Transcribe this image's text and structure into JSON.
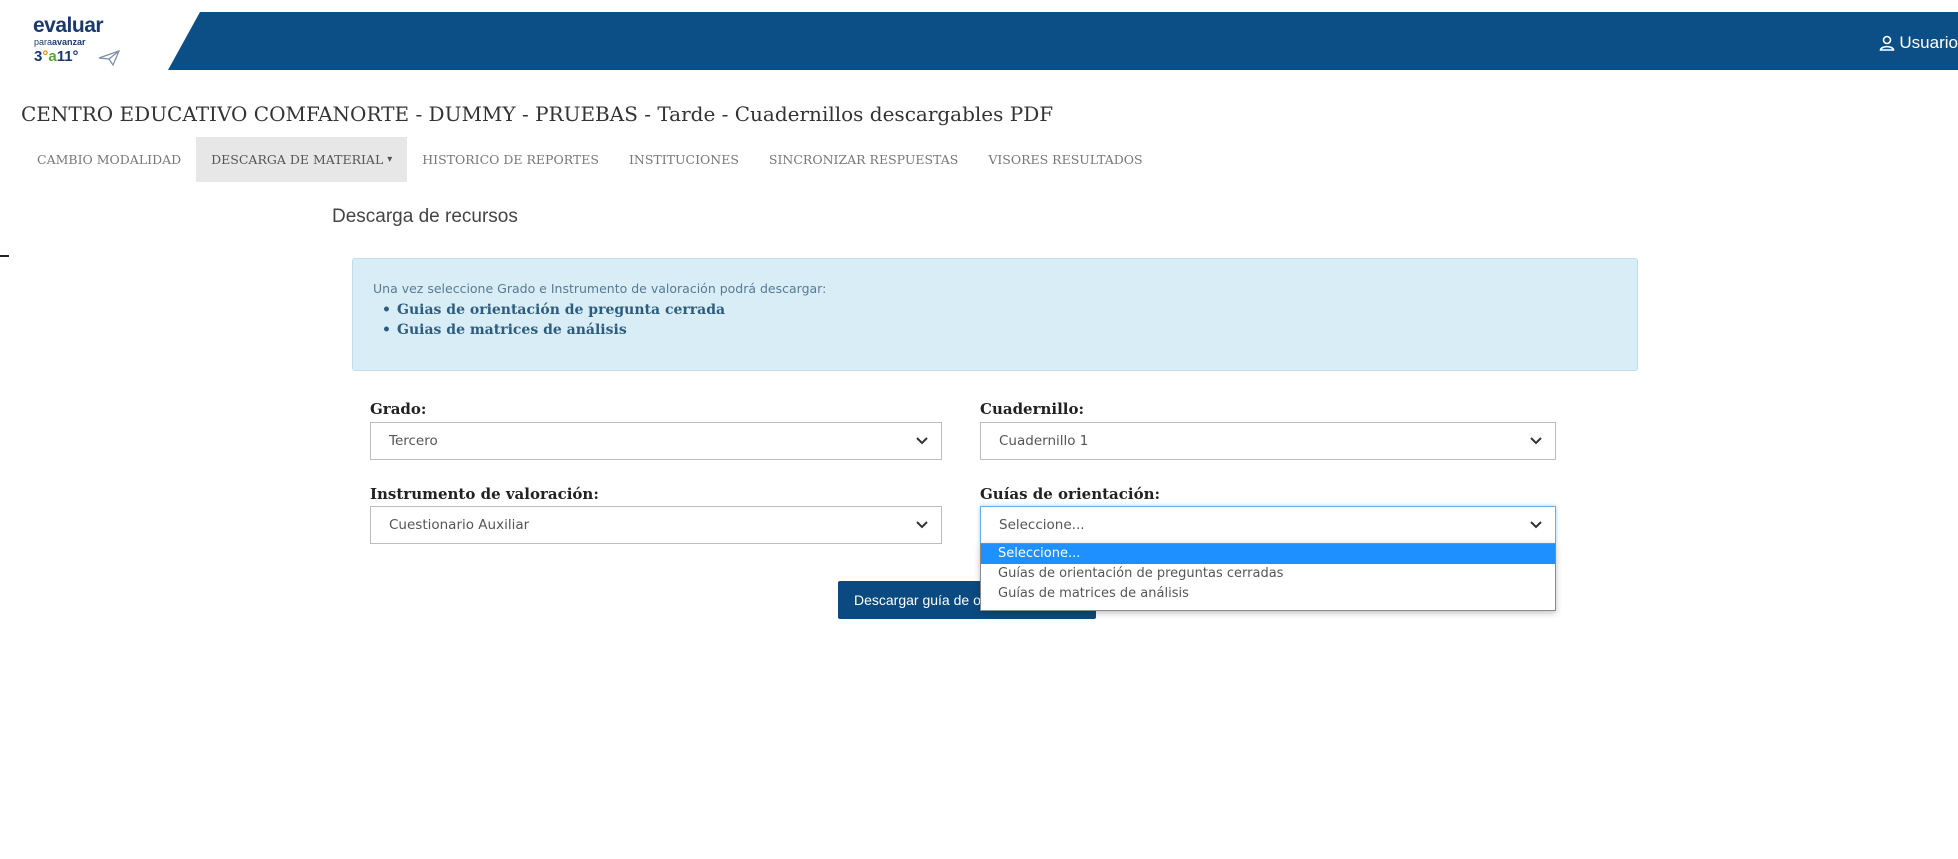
{
  "header": {
    "logo": {
      "word": "evaluar",
      "sub_prefix": "para",
      "sub_strong": "avanzar",
      "number": "3",
      "grade_a": "°",
      "grade_b": "a",
      "grade_c": "11°"
    },
    "user_label": "Usuario"
  },
  "page": {
    "title": "CENTRO EDUCATIVO COMFANORTE - DUMMY - PRUEBAS - Tarde - Cuadernillos descargables PDF"
  },
  "nav": {
    "items": [
      {
        "label": "CAMBIO MODALIDAD"
      },
      {
        "label": "DESCARGA DE MATERIAL"
      },
      {
        "label": "HISTORICO DE REPORTES"
      },
      {
        "label": "INSTITUCIONES"
      },
      {
        "label": "SINCRONIZAR RESPUESTAS"
      },
      {
        "label": "VISORES RESULTADOS"
      }
    ]
  },
  "main": {
    "section_title": "Descarga de recursos",
    "info": {
      "intro": "Una vez seleccione Grado e Instrumento de valoración podrá descargar:",
      "items": [
        "Guias de orientación de pregunta cerrada",
        "Guias de matrices de análisis"
      ]
    },
    "form": {
      "grado": {
        "label": "Grado:",
        "value": "Tercero"
      },
      "cuadernillo": {
        "label": "Cuadernillo:",
        "value": "Cuadernillo 1"
      },
      "instrumento": {
        "label": "Instrumento de valoración:",
        "value": "Cuestionario Auxiliar"
      },
      "guias": {
        "label": "Guías de orientación:",
        "value": "Seleccione...",
        "options": [
          "Seleccione...",
          "Guías de orientación de preguntas cerradas",
          "Guías de matrices de análisis"
        ]
      }
    },
    "download_button": "Descargar guía de orientación"
  },
  "colors": {
    "header_bg": "#0b4f86",
    "info_bg": "#d9edf7",
    "button_bg": "#0b4a80",
    "option_highlight": "#1e90ff"
  },
  "icons": [
    "user-icon",
    "paper-plane-icon",
    "chevron-down-icon",
    "caret-down-icon"
  ]
}
